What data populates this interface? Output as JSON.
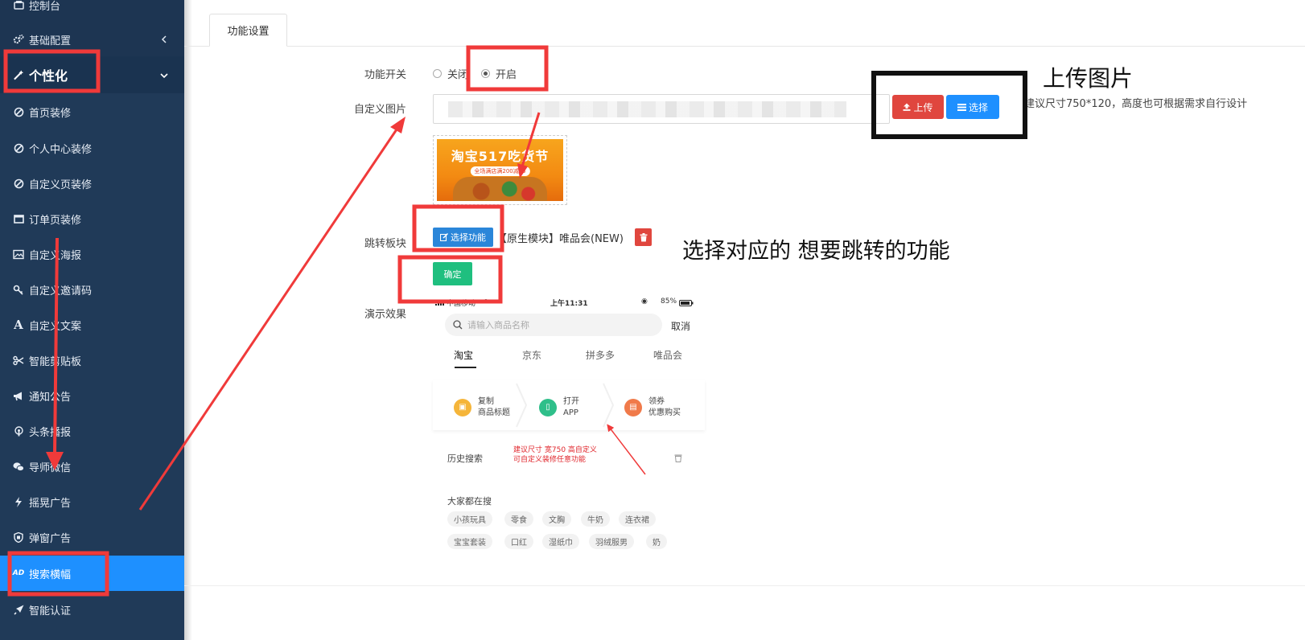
{
  "sidebar": {
    "items": [
      {
        "label": "控制台",
        "icon": "dashboard-icon"
      },
      {
        "label": "基础配置",
        "icon": "gears-icon"
      },
      {
        "label": "个性化",
        "icon": "magic-wand-icon"
      },
      {
        "label": "首页装修",
        "icon": "no-slash-icon"
      },
      {
        "label": "个人中心装修",
        "icon": "no-slash-icon"
      },
      {
        "label": "自定义页装修",
        "icon": "no-slash-icon"
      },
      {
        "label": "订单页装修",
        "icon": "window-icon"
      },
      {
        "label": "自定义海报",
        "icon": "image-icon"
      },
      {
        "label": "自定义邀请码",
        "icon": "key-icon"
      },
      {
        "label": "自定义文案",
        "icon": "font-icon"
      },
      {
        "label": "智能剪贴板",
        "icon": "scissors-icon"
      },
      {
        "label": "通知公告",
        "icon": "bullhorn-icon"
      },
      {
        "label": "头条播报",
        "icon": "podcast-icon"
      },
      {
        "label": "导师微信",
        "icon": "wechat-icon"
      },
      {
        "label": "摇晃广告",
        "icon": "bolt-icon"
      },
      {
        "label": "弹窗广告",
        "icon": "shield-icon"
      },
      {
        "label": "搜索横幅",
        "icon": "ad-icon"
      },
      {
        "label": "智能认证",
        "icon": "rocket-icon"
      }
    ]
  },
  "tabs": {
    "active": "功能设置"
  },
  "form": {
    "switch_label": "功能开关",
    "off_label": "关闭",
    "on_label": "开启",
    "image_label": "自定义图片",
    "upload_label": "上传",
    "choose_label": "选择",
    "size_hint": "建议尺寸750*120，高度也可根据需求自行设计",
    "jump_label": "跳转板块",
    "select_func_label": "选择功能",
    "jump_value": "【原生模块】唯品会(NEW)",
    "confirm_label": "确定",
    "demo_label": "演示效果"
  },
  "banner": {
    "title": "淘宝517吃货节",
    "subtitle": "全场满店满200减15"
  },
  "phone": {
    "carrier": "中国移动",
    "time": "上午11:31",
    "battery": "85%",
    "search_placeholder": "请输入商品名称",
    "cancel": "取消",
    "tabs": [
      "淘宝",
      "京东",
      "拼多多",
      "唯品会"
    ],
    "steps": [
      {
        "line1": "复制",
        "line2": "商品标题"
      },
      {
        "line1": "打开",
        "line2": "APP"
      },
      {
        "line1": "领券",
        "line2": "优惠购买"
      }
    ],
    "history_label": "历史搜索",
    "note_line1": "建议尺寸 宽750 高自定义",
    "note_line2": "可自定义装修任意功能",
    "hot_label": "大家都在搜",
    "hot_row1": [
      "小孩玩具",
      "零食",
      "文胸",
      "牛奶",
      "连衣裙"
    ],
    "hot_row2": [
      "宝宝套装",
      "口红",
      "湿纸巾",
      "羽绒服男",
      "奶"
    ]
  },
  "annotations": {
    "upload_image": "上传图片",
    "choose_function": "选择对应的 想要跳转的功能"
  },
  "colors": {
    "sidebar_bg": "#203a58",
    "active_bg": "#1e90ff",
    "highlight": "#f03a3a",
    "upload_btn": "#e0463e",
    "choose_btn": "#1e90ff",
    "confirm_btn": "#1fbf7f"
  }
}
